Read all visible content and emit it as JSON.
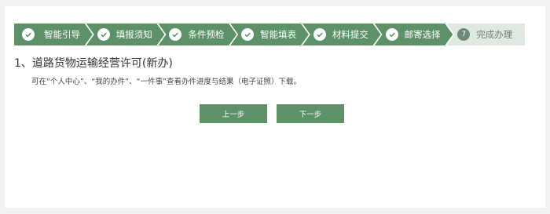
{
  "steps": [
    {
      "label": "智能引导",
      "icon": "check-icon",
      "state": "done"
    },
    {
      "label": "填报须知",
      "icon": "check-icon",
      "state": "done"
    },
    {
      "label": "条件预检",
      "icon": "check-icon",
      "state": "done"
    },
    {
      "label": "智能填表",
      "icon": "check-icon",
      "state": "done"
    },
    {
      "label": "材料提交",
      "icon": "check-icon",
      "state": "done"
    },
    {
      "label": "邮寄选择",
      "icon": "check-icon",
      "state": "done"
    },
    {
      "label": "完成办理",
      "number": "7",
      "state": "current"
    }
  ],
  "main": {
    "title": "1、道路货物运输经营许可(新办)",
    "description": "可在“个人中心”、“我的办件”、“一件事”查看办件进度与结果（电子证照）下载。"
  },
  "buttons": {
    "prev_label": "上一步",
    "next_label": "下一步"
  },
  "colors": {
    "accent": "#5d9268",
    "current_step_bg": "#dfe9e1"
  }
}
